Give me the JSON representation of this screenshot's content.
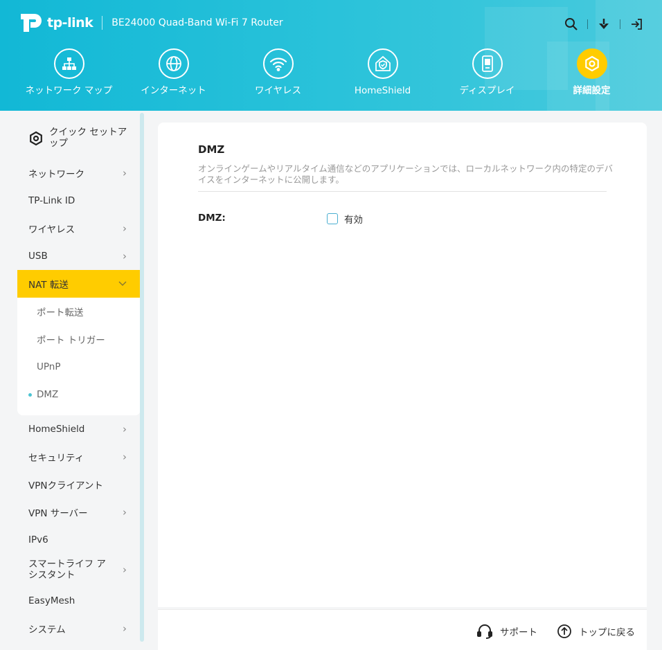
{
  "header": {
    "logo_text": "tp-link",
    "model": "BE24000 Quad-Band Wi-Fi 7 Router",
    "nav": [
      {
        "label": "ネットワーク マップ",
        "icon": "network-map-icon",
        "active": false
      },
      {
        "label": "インターネット",
        "icon": "globe-icon",
        "active": false
      },
      {
        "label": "ワイヤレス",
        "icon": "wifi-icon",
        "active": false
      },
      {
        "label": "HomeShield",
        "icon": "home-shield-icon",
        "active": false
      },
      {
        "label": "ディスプレイ",
        "icon": "display-icon",
        "active": false
      },
      {
        "label": "詳細設定",
        "icon": "gear-icon",
        "active": true
      }
    ],
    "tools": [
      "search-icon",
      "download-icon",
      "logout-icon"
    ]
  },
  "sidebar": {
    "quick_setup": "クイック セットアップ",
    "items": [
      {
        "label": "ネットワーク",
        "chevron": true
      },
      {
        "label": "TP-Link ID",
        "chevron": false
      },
      {
        "label": "ワイヤレス",
        "chevron": true
      },
      {
        "label": "USB",
        "chevron": true
      },
      {
        "label": "NAT 転送",
        "chevron": true,
        "expanded": true
      }
    ],
    "sub_items": [
      {
        "label": "ポート転送",
        "active": false
      },
      {
        "label": "ポート トリガー",
        "active": false
      },
      {
        "label": "UPnP",
        "active": false
      },
      {
        "label": "DMZ",
        "active": true
      }
    ],
    "items_after": [
      {
        "label": "HomeShield",
        "chevron": true
      },
      {
        "label": "セキュリティ",
        "chevron": true
      },
      {
        "label": "VPNクライアント",
        "chevron": false
      },
      {
        "label": "VPN サーバー",
        "chevron": true
      },
      {
        "label": "IPv6",
        "chevron": false
      },
      {
        "label": "スマートライフ アシスタント",
        "chevron": true,
        "two_line": true
      },
      {
        "label": "EasyMesh",
        "chevron": false
      },
      {
        "label": "システム",
        "chevron": true
      }
    ]
  },
  "main": {
    "title": "DMZ",
    "description": "オンラインゲームやリアルタイム通信などのアプリケーションでは、ローカルネットワーク内の特定のデバイスをインターネットに公開します。",
    "field_label": "DMZ:",
    "checkbox_label": "有効",
    "checkbox_checked": false
  },
  "footer": {
    "support": "サポート",
    "back_to_top": "トップに戻る"
  },
  "colors": {
    "header_start": "#12b8d6",
    "header_end": "#49cadd",
    "active_yellow": "#ffcc00",
    "accent_teal": "#4dc4d2"
  }
}
